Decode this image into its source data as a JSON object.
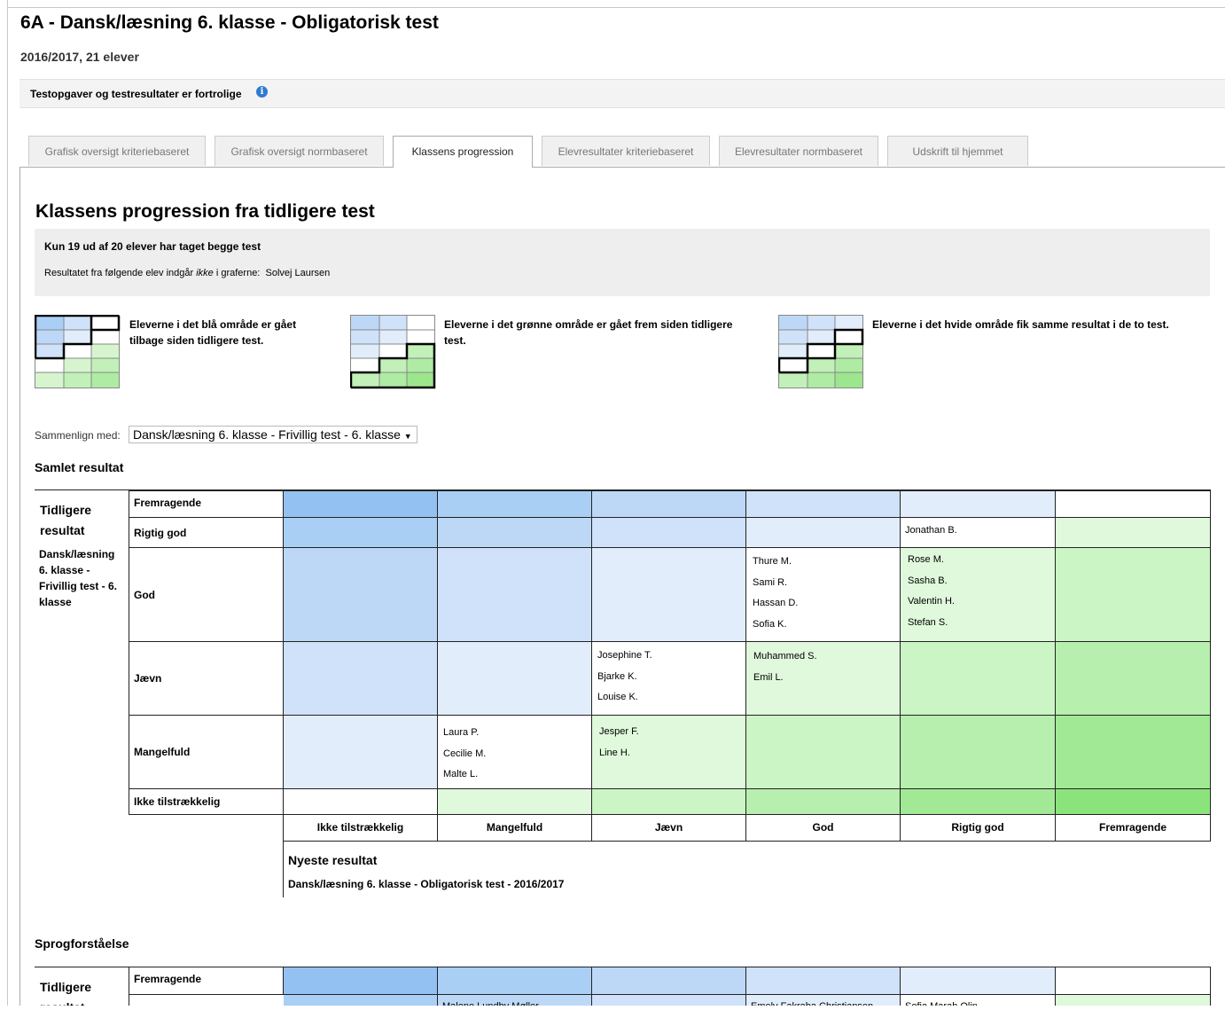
{
  "page_title": "6A - Dansk/læsning 6. klasse - Obligatorisk test",
  "subtitle": "2016/2017, 21 elever",
  "confidential_label": "Testopgaver og testresultater er fortrolige",
  "tabs": [
    {
      "label": "Grafisk oversigt kriteriebaseret"
    },
    {
      "label": "Grafisk oversigt normbaseret"
    },
    {
      "label": "Klassens progression"
    },
    {
      "label": "Elevresultater kriteriebaseret"
    },
    {
      "label": "Elevresultater normbaseret"
    },
    {
      "label": "Udskrift til hjemmet"
    }
  ],
  "active_tab": "Klassens progression",
  "section_title": "Klassens progression fra tidligere test",
  "notice": {
    "bold": "Kun 19 ud af 20 elever har taget begge test",
    "text_before": "Resultatet fra følgende elev indgår ",
    "text_italic": "ikke",
    "text_after": " i graferne:  ",
    "student": "Solvej Laursen"
  },
  "legend": [
    {
      "text": "Eleverne i det blå område er gået tilbage siden tidligere test."
    },
    {
      "text": "Eleverne i det grønne område er gået frem siden tidligere test."
    },
    {
      "text": "Eleverne i det hvide område fik samme resultat i de to test."
    }
  ],
  "compare": {
    "label": "Sammenlign med:",
    "selected": "Dansk/læsning 6. klasse - Frivillig test - 6. klasse"
  },
  "sections": {
    "samlet": "Samlet resultat",
    "sprog": "Sprogforståelse"
  },
  "matrix": {
    "y_title_1": "Tidligere",
    "y_title_2": "resultat",
    "y_subtitle": "Dansk/læsning 6. klasse - Frivillig test - 6. klasse",
    "rows": [
      "Fremragende",
      "Rigtig god",
      "God",
      "Jævn",
      "Mangelfuld",
      "Ikke tilstrækkelig"
    ],
    "cols": [
      "Ikke tilstrækkelig",
      "Mangelfuld",
      "Jævn",
      "God",
      "Rigtig god",
      "Fremragende"
    ],
    "x_title": "Nyeste resultat",
    "x_subtitle": "Dansk/læsning 6. klasse - Obligatorisk test - 2016/2017",
    "cells": {
      "r1c4": [
        "Jonathan B."
      ],
      "r2c3": [
        "Thure M.",
        "Sami R.",
        "Hassan D.",
        "Sofia K."
      ],
      "r2c4": [
        "Rose M.",
        "Sasha B.",
        "Valentin H.",
        "Stefan S."
      ],
      "r3c2": [
        "Josephine T.",
        "Bjarke K.",
        "Louise K."
      ],
      "r3c3": [
        "Muhammed S.",
        "Emil L."
      ],
      "r4c1": [
        "Laura P.",
        "Cecilie M.",
        "Malte L."
      ],
      "r4c2": [
        "Jesper F.",
        "Line H."
      ]
    }
  },
  "matrix2": {
    "y_title_1": "Tidligere",
    "y_title_2": "resultat",
    "row1": "Fremragende",
    "partial_names": [
      "Malene Lundby Møller",
      "Emely Fakraba Christiansen",
      "Sofia Marah Olin"
    ]
  },
  "colors": {
    "blue1": "#93c2f2",
    "blue2": "#a9cff4",
    "blue3": "#bcd8f6",
    "blue4": "#cfe2f9",
    "blue5": "#e2edfb",
    "green1": "#e0f9dc",
    "green2": "#ccf5c5",
    "green3": "#b7efae",
    "green4": "#a2e995",
    "green5": "#8be47b"
  }
}
